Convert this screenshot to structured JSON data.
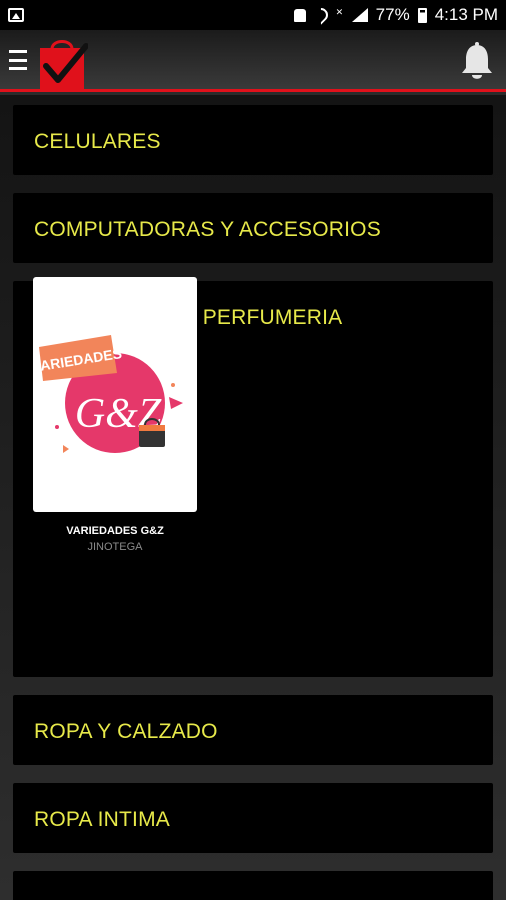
{
  "status_bar": {
    "battery": "77%",
    "time": "4:13 PM"
  },
  "header": {
    "menu_icon": "hamburger-menu-icon",
    "logo": "shopping-bag-check-logo",
    "notification_icon": "bell-icon"
  },
  "categories": [
    {
      "label": "CELULARES"
    },
    {
      "label": "COMPUTADORAS Y ACCESORIOS"
    },
    {
      "label": "COSMETICOS Y PERFUMERIA",
      "shops": [
        {
          "name": "VARIEDADES G&Z",
          "city": "JINOTEGA",
          "logo_text_top": "VARIEDADES",
          "logo_text_mid": "G&Z"
        }
      ]
    },
    {
      "label": "ROPA Y CALZADO"
    },
    {
      "label": "ROPA INTIMA"
    }
  ],
  "colors": {
    "accent_red": "#e0111b",
    "category_text": "#e7e94a"
  }
}
